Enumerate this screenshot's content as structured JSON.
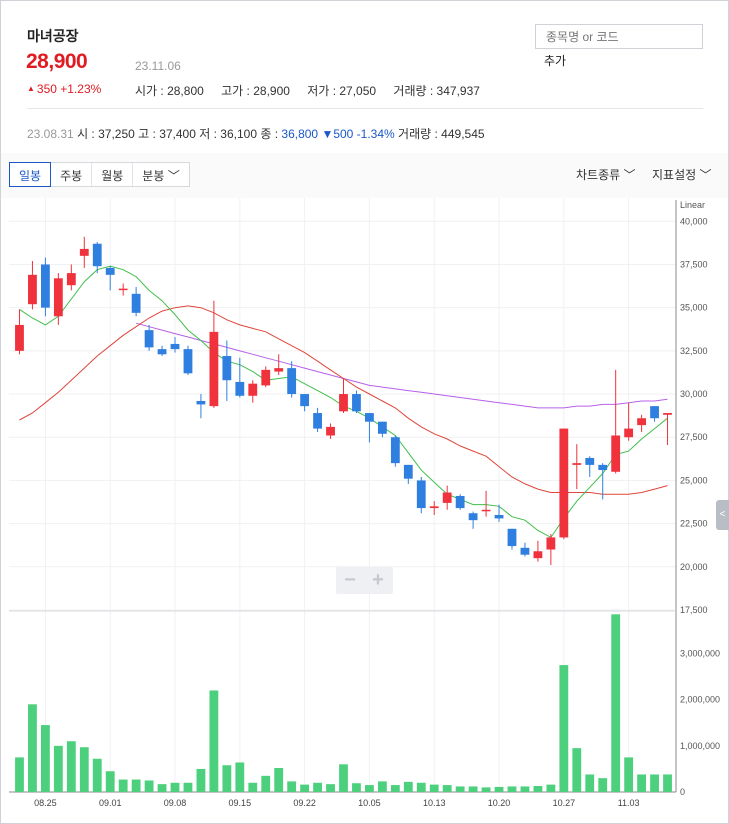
{
  "stock": {
    "name": "마녀공장",
    "price": "28,900",
    "date": "23.11.06",
    "change": "350 +1.23%",
    "open": "시가 : 28,800",
    "high": "고가 : 28,900",
    "low": "저가 : 27,050",
    "volume": "거래량 : 347,937"
  },
  "search": {
    "placeholder": "종목명 or 코드",
    "add_label": "추가"
  },
  "previous": {
    "date": "23.08.31",
    "open": "시 : 37,250",
    "high": "고 : 37,400",
    "low": "저 : 36,100",
    "close_label": "종 : ",
    "close_value": "36,800",
    "change": "▼500 -1.34%",
    "volume": "거래량 : 449,545"
  },
  "toolbar": {
    "tabs": [
      "일봉",
      "주봉",
      "월봉",
      "분봉"
    ],
    "active_tab": "일봉",
    "chart_type": "차트종류",
    "indicator": "지표설정"
  },
  "colors": {
    "up": "#f0323c",
    "down": "#2f7fe0",
    "ma_short": "#3fbf4a",
    "ma_mid": "#e0463c",
    "ma_long": "#b760e8",
    "volume": "#4cd07d",
    "accent": "#1a58c7"
  },
  "chart_data": {
    "type": "candlestick",
    "scale": "Linear",
    "price_axis": {
      "range": [
        17500,
        41000
      ],
      "ticks": [
        "17,500",
        "20,000",
        "22,500",
        "25,000",
        "27,500",
        "30,000",
        "32,500",
        "35,000",
        "37,500",
        "40,000"
      ]
    },
    "volume_axis": {
      "range": [
        0,
        3900000
      ],
      "ticks": [
        "0",
        "1,000,000",
        "2,000,000",
        "3,000,000"
      ]
    },
    "x_labels": [
      "08.25",
      "09.01",
      "09.08",
      "09.15",
      "09.22",
      "10.05",
      "10.13",
      "10.20",
      "10.27",
      "11.03"
    ],
    "x_label_positions": [
      2,
      7,
      12,
      17,
      22,
      27,
      32,
      37,
      42,
      47
    ],
    "candles": [
      {
        "o": 32500,
        "c": 34000,
        "h": 34900,
        "l": 32300
      },
      {
        "o": 35200,
        "c": 36900,
        "h": 37700,
        "l": 34900
      },
      {
        "o": 37500,
        "c": 35000,
        "h": 37900,
        "l": 34500
      },
      {
        "o": 34500,
        "c": 36700,
        "h": 37000,
        "l": 34000
      },
      {
        "o": 36300,
        "c": 37000,
        "h": 37500,
        "l": 36000
      },
      {
        "o": 38000,
        "c": 38400,
        "h": 39100,
        "l": 37300
      },
      {
        "o": 38700,
        "c": 37400,
        "h": 38800,
        "l": 37000
      },
      {
        "o": 37300,
        "c": 36900,
        "h": 37400,
        "l": 36000
      },
      {
        "o": 36100,
        "c": 36100,
        "h": 36400,
        "l": 35700
      },
      {
        "o": 35800,
        "c": 34700,
        "h": 36200,
        "l": 34500
      },
      {
        "o": 33700,
        "c": 32700,
        "h": 34000,
        "l": 32500
      },
      {
        "o": 32600,
        "c": 32300,
        "h": 32800,
        "l": 32200
      },
      {
        "o": 32900,
        "c": 32600,
        "h": 33300,
        "l": 32400
      },
      {
        "o": 32600,
        "c": 31200,
        "h": 32800,
        "l": 31100
      },
      {
        "o": 29600,
        "c": 29400,
        "h": 30000,
        "l": 28600
      },
      {
        "o": 29300,
        "c": 33600,
        "h": 35400,
        "l": 29200
      },
      {
        "o": 32200,
        "c": 30800,
        "h": 33100,
        "l": 29600
      },
      {
        "o": 30700,
        "c": 29900,
        "h": 32100,
        "l": 29800
      },
      {
        "o": 29900,
        "c": 30600,
        "h": 30800,
        "l": 29500
      },
      {
        "o": 30500,
        "c": 31400,
        "h": 31600,
        "l": 30400
      },
      {
        "o": 31300,
        "c": 31500,
        "h": 32300,
        "l": 31100
      },
      {
        "o": 31500,
        "c": 30000,
        "h": 31900,
        "l": 29800
      },
      {
        "o": 30000,
        "c": 29300,
        "h": 30000,
        "l": 29000
      },
      {
        "o": 28900,
        "c": 28000,
        "h": 29200,
        "l": 27800
      },
      {
        "o": 27600,
        "c": 28100,
        "h": 28300,
        "l": 27400
      },
      {
        "o": 29000,
        "c": 30000,
        "h": 30900,
        "l": 28900
      },
      {
        "o": 30000,
        "c": 29000,
        "h": 30200,
        "l": 28900
      },
      {
        "o": 28900,
        "c": 28400,
        "h": 28900,
        "l": 27200
      },
      {
        "o": 28400,
        "c": 27700,
        "h": 28400,
        "l": 27500
      },
      {
        "o": 27500,
        "c": 26000,
        "h": 27600,
        "l": 25800
      },
      {
        "o": 25900,
        "c": 25100,
        "h": 25900,
        "l": 24800
      },
      {
        "o": 25000,
        "c": 23400,
        "h": 25200,
        "l": 23100
      },
      {
        "o": 23400,
        "c": 23500,
        "h": 23800,
        "l": 23000
      },
      {
        "o": 23700,
        "c": 24300,
        "h": 24700,
        "l": 23300
      },
      {
        "o": 24100,
        "c": 23400,
        "h": 24200,
        "l": 23300
      },
      {
        "o": 23100,
        "c": 22700,
        "h": 23200,
        "l": 22200
      },
      {
        "o": 23300,
        "c": 23300,
        "h": 24400,
        "l": 22900
      },
      {
        "o": 23000,
        "c": 22800,
        "h": 23600,
        "l": 22600
      },
      {
        "o": 22200,
        "c": 21200,
        "h": 22200,
        "l": 21000
      },
      {
        "o": 21100,
        "c": 20700,
        "h": 21400,
        "l": 20600
      },
      {
        "o": 20500,
        "c": 20900,
        "h": 21500,
        "l": 20300
      },
      {
        "o": 21000,
        "c": 21700,
        "h": 21900,
        "l": 20100
      },
      {
        "o": 21700,
        "c": 28000,
        "h": 28000,
        "l": 21600
      },
      {
        "o": 25900,
        "c": 26000,
        "h": 27100,
        "l": 24500
      },
      {
        "o": 26300,
        "c": 25900,
        "h": 26400,
        "l": 25200
      },
      {
        "o": 25900,
        "c": 25600,
        "h": 26000,
        "l": 23900
      },
      {
        "o": 25500,
        "c": 27600,
        "h": 31400,
        "l": 25400
      },
      {
        "o": 27500,
        "c": 28000,
        "h": 29500,
        "l": 27300
      },
      {
        "o": 28200,
        "c": 28600,
        "h": 28800,
        "l": 27800
      },
      {
        "o": 29300,
        "c": 28600,
        "h": 29300,
        "l": 28400
      },
      {
        "o": 28800,
        "c": 28900,
        "h": 28900,
        "l": 27050
      }
    ],
    "ma_short": [
      34900,
      34400,
      34000,
      34500,
      35500,
      36500,
      37200,
      37400,
      37200,
      36800,
      36000,
      35400,
      34600,
      33700,
      33100,
      32400,
      31900,
      31700,
      31300,
      30800,
      30900,
      31000,
      30600,
      30200,
      29800,
      29300,
      29000,
      28600,
      28100,
      27600,
      26600,
      25600,
      24900,
      24200,
      23900,
      23600,
      23600,
      23500,
      22900,
      22700,
      22100,
      21700,
      22800,
      23800,
      24600,
      25400,
      26500,
      26700,
      27400,
      28000,
      28600
    ],
    "ma_mid": [
      28500,
      28900,
      29500,
      30100,
      30800,
      31500,
      32200,
      32800,
      33400,
      33900,
      34400,
      34800,
      35000,
      35100,
      35000,
      34700,
      34300,
      34000,
      33800,
      33600,
      33200,
      32800,
      32400,
      31900,
      31400,
      30900,
      30400,
      30000,
      29600,
      29200,
      28600,
      28100,
      27700,
      27400,
      27000,
      26700,
      26400,
      25800,
      25200,
      24800,
      24500,
      24300,
      24300,
      24300,
      24300,
      24200,
      24200,
      24200,
      24300,
      24500,
      24700
    ],
    "ma_long": [
      null,
      null,
      null,
      null,
      null,
      null,
      null,
      null,
      null,
      34100,
      33900,
      33700,
      33500,
      33300,
      33100,
      32900,
      32700,
      32500,
      32300,
      32100,
      31900,
      31700,
      31500,
      31300,
      31100,
      30900,
      30700,
      30500,
      30400,
      30300,
      30200,
      30100,
      30000,
      29900,
      29800,
      29700,
      29600,
      29500,
      29400,
      29300,
      29200,
      29200,
      29200,
      29300,
      29300,
      29400,
      29400,
      29500,
      29600,
      29600,
      29700
    ],
    "volumes": [
      750000,
      1900000,
      1450000,
      1000000,
      1100000,
      970000,
      720000,
      450000,
      270000,
      270000,
      250000,
      170000,
      200000,
      200000,
      500000,
      2200000,
      580000,
      640000,
      200000,
      350000,
      520000,
      230000,
      160000,
      200000,
      170000,
      600000,
      190000,
      150000,
      230000,
      150000,
      220000,
      200000,
      160000,
      150000,
      120000,
      120000,
      100000,
      110000,
      120000,
      120000,
      130000,
      160000,
      2750000,
      950000,
      380000,
      300000,
      3850000,
      750000,
      380000,
      380000,
      380000
    ]
  }
}
